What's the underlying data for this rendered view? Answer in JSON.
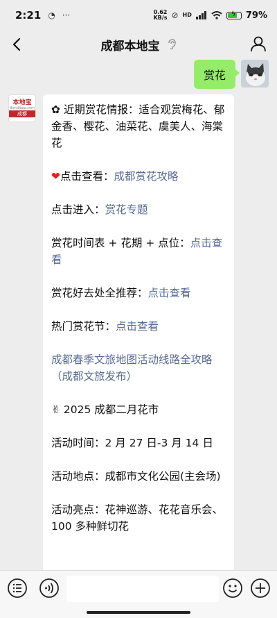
{
  "status_bar": {
    "time": "2:21",
    "speed_value": "0.62",
    "speed_unit": "KB/s",
    "network": "HD",
    "battery_percent": "79%",
    "battery_level": 0.79
  },
  "header": {
    "back_icon": "back-arrow-icon",
    "title": "成都本地宝",
    "title_icon": "ear-icon",
    "profile_icon": "user-icon"
  },
  "messages": {
    "sent": {
      "text": "赏花"
    },
    "bot_avatar": {
      "line1": "本地宝",
      "line2": "Bendibao.com",
      "line3": "成都"
    },
    "received": {
      "p1": "✿ 近期赏花情报：适合观赏梅花、郁金香、樱花、油菜花、虞美人、海棠花",
      "p2_prefix": "点击查看：",
      "p2_link": "成都赏花攻略",
      "p3_prefix": "点击进入：",
      "p3_link": "赏花专题",
      "p4_prefix": "赏花时间表 + 花期 + 点位：",
      "p4_link": "点击查看",
      "p5_prefix": "赏花好去处全推荐：",
      "p5_link": "点击查看",
      "p6_prefix": "热门赏花节：",
      "p6_link": "点击查看",
      "p7_link": "成都春季文旅地图活动线路全攻略（成都文旅发布）",
      "p8": "✌ 2025 成都二月花市",
      "p9": "活动时间：2 月 27 日-3 月 14 日",
      "p10": "活动地点：成都市文化公园(主会场)",
      "p11": "活动亮点：花神巡游、花花音乐会、100 多种鲜切花"
    }
  },
  "bottom_bar": {
    "menu_icon": "list-menu-icon",
    "voice_icon": "voice-icon",
    "emoji_icon": "emoji-icon",
    "plus_icon": "plus-icon",
    "input_value": ""
  }
}
